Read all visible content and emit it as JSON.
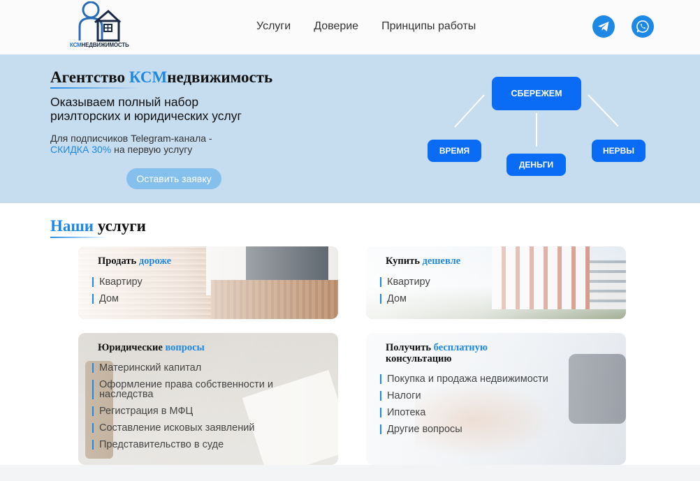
{
  "brand": {
    "logo_prefix": "КСМ",
    "logo_suffix": "НЕДВИЖИМОСТЬ"
  },
  "nav": [
    "Услуги",
    "Доверие",
    "Принципы работы"
  ],
  "social": {
    "telegram": "telegram-icon",
    "whatsapp": "whatsapp-icon"
  },
  "hero": {
    "title_pre": "Агентство ",
    "title_accent": "КСМ",
    "title_post": "недвижимость",
    "subtitle_line1": "Оказываем полный набор",
    "subtitle_line2": "риэлторских и юридических услуг",
    "promo_line1": "Для подписчиков Telegram-канала -",
    "promo_accent": "СКИДКА 30%",
    "promo_post": " на первую услугу",
    "cta": "Оставить заявку",
    "pills": {
      "save": "СБЕРЕЖЕМ",
      "time": "ВРЕМЯ",
      "money": "ДЕНЬГИ",
      "nerves": "НЕРВЫ"
    }
  },
  "services": {
    "title_accent": "Наши",
    "title_post": " услуги",
    "cards": [
      {
        "title": "Продать ",
        "accent": "дороже",
        "items": [
          "Квартиру",
          "Дом"
        ]
      },
      {
        "title": "Купить ",
        "accent": "дешевле",
        "items": [
          "Квартиру",
          "Дом"
        ]
      },
      {
        "title": "Юридические ",
        "accent": "вопросы",
        "items": [
          "Материнский капитал",
          "Оформление права собственности и наследства",
          "Регистрация в МФЦ",
          "Составление исковых заявлений",
          "Представительство в суде"
        ]
      },
      {
        "title": "Получить ",
        "accent": "бесплатную",
        "title2": "консультацию",
        "items": [
          "Покупка и продажа недвижимости",
          "Налоги",
          "Ипотека",
          "Другие вопросы"
        ]
      }
    ]
  },
  "colors": {
    "accent": "#1e88e5",
    "pill": "#0a6cf5",
    "hero_bg": "#c6dcef"
  }
}
